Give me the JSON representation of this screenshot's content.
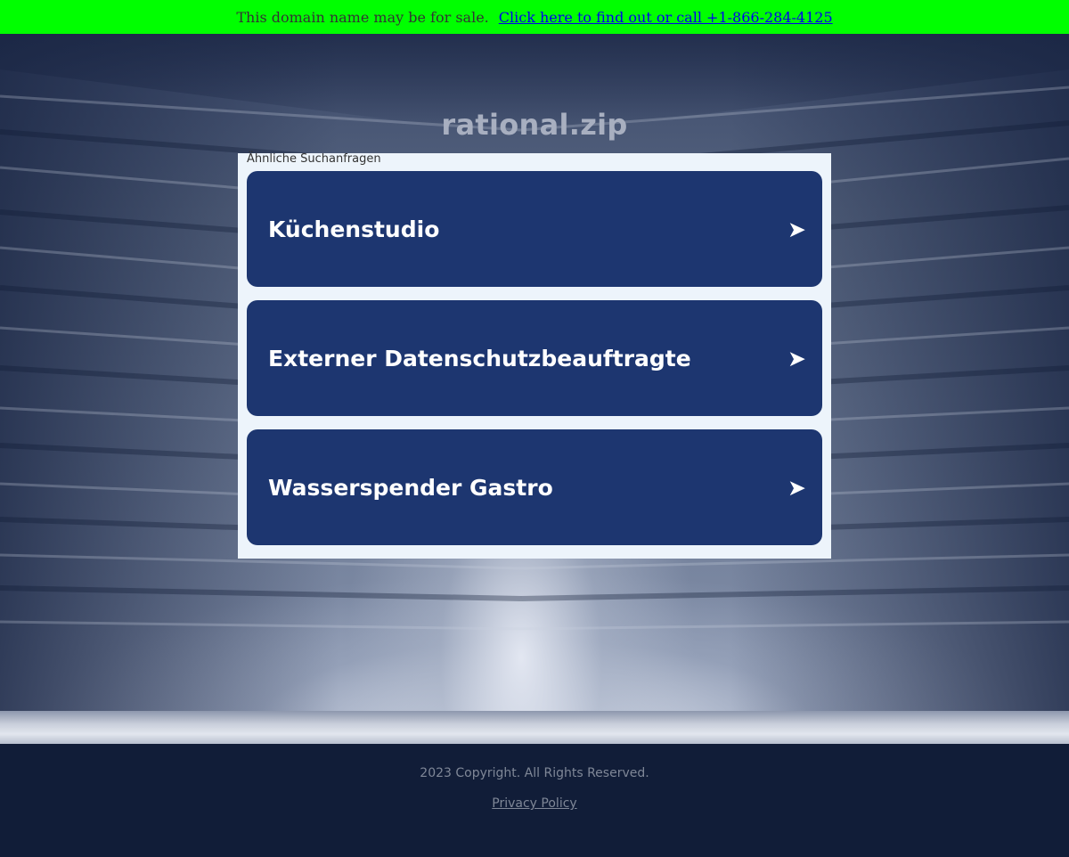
{
  "banner": {
    "text": "This domain name may be for sale.",
    "link_text": "Click here to find out or call +1-866-284-4125"
  },
  "site": {
    "title": "rational.zip"
  },
  "results": {
    "heading": "Ähnliche Suchanfragen",
    "items": [
      {
        "label": "Küchenstudio",
        "arrow": "➤"
      },
      {
        "label": "Externer Datenschutzbeauftragte",
        "arrow": "➤"
      },
      {
        "label": "Wasserspender Gastro",
        "arrow": "➤"
      }
    ]
  },
  "footer": {
    "copyright": "2023 Copyright. All Rights Reserved.",
    "privacy_label": "Privacy Policy "
  },
  "colors": {
    "banner_bg": "#00ff00",
    "result_bg": "#1d3670",
    "panel_bg": "#edf4fb",
    "footer_bg": "#111d38"
  }
}
